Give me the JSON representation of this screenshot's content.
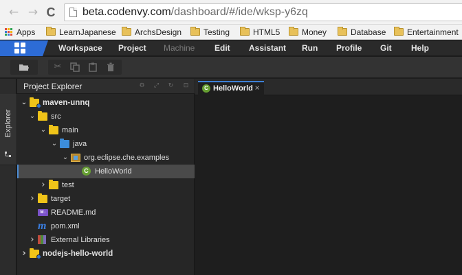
{
  "browser": {
    "back_glyph": "←",
    "forward_glyph": "→",
    "reload_glyph": "C",
    "url_host": "beta.codenvy.com",
    "url_path": "/dashboard/#/ide/wksp-y6zq",
    "bookmarks": [
      "Apps",
      "LearnJapanese",
      "ArchsDesign",
      "Testing",
      "HTML5",
      "Money",
      "Database",
      "Entertainment"
    ]
  },
  "menubar": {
    "items": [
      "Workspace",
      "Project",
      "Machine",
      "Edit",
      "Assistant",
      "Run",
      "Profile",
      "Git",
      "Help"
    ],
    "disabled": [
      "Machine"
    ]
  },
  "toolbar": {
    "icons": [
      "new-folder-icon",
      "cut-icon",
      "copy-icon",
      "paste-icon",
      "delete-icon"
    ]
  },
  "leftstrip": {
    "explorer_label": "Explorer"
  },
  "explorer": {
    "title": "Project Explorer",
    "tree": [
      {
        "label": "maven-unnq",
        "level": 0,
        "expanded": true,
        "icon": "project-folder-icon",
        "bold": true
      },
      {
        "label": "src",
        "level": 1,
        "expanded": true,
        "icon": "folder-icon"
      },
      {
        "label": "main",
        "level": 2,
        "expanded": true,
        "icon": "folder-icon"
      },
      {
        "label": "java",
        "level": 3,
        "expanded": true,
        "icon": "source-folder-icon"
      },
      {
        "label": "org.eclipse.che.examples",
        "level": 4,
        "expanded": true,
        "icon": "package-icon"
      },
      {
        "label": "HelloWorld",
        "level": 5,
        "icon": "java-class-icon",
        "selected": true
      },
      {
        "label": "test",
        "level": 2,
        "expanded": false,
        "icon": "folder-icon"
      },
      {
        "label": "target",
        "level": 1,
        "expanded": false,
        "icon": "folder-icon"
      },
      {
        "label": "README.md",
        "level": 1,
        "icon": "markdown-file-icon"
      },
      {
        "label": "pom.xml",
        "level": 1,
        "icon": "maven-file-icon"
      },
      {
        "label": "External Libraries",
        "level": 1,
        "expanded": false,
        "icon": "library-icon"
      },
      {
        "label": "nodejs-hello-world",
        "level": 0,
        "expanded": false,
        "icon": "project-folder-icon",
        "bold": true
      }
    ]
  },
  "editor": {
    "tab_label": "HelloWorld",
    "tab_icon_letter": "C",
    "tab_close": "×"
  },
  "colors": {
    "accent_blue": "#2d6cd6",
    "folder_yellow": "#f0c419",
    "class_green": "#67a033"
  }
}
